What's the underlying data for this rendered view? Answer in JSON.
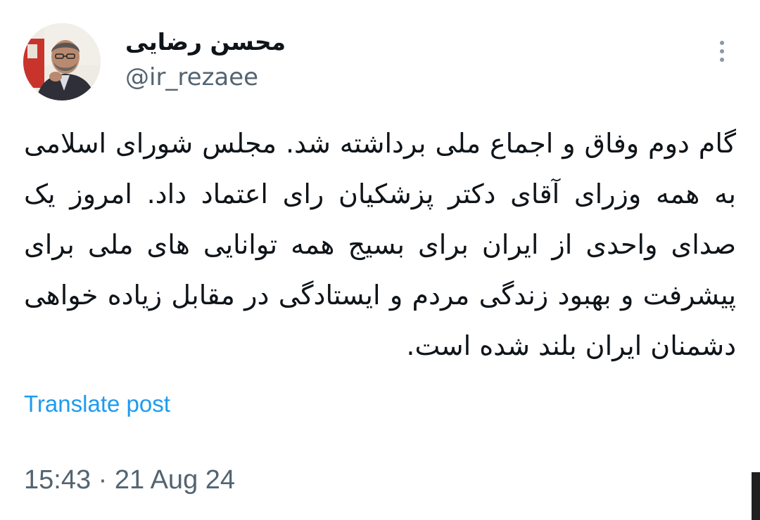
{
  "author": {
    "display_name": "محسن رضایی",
    "handle": "@ir_rezaee",
    "avatar_icon": "profile-photo"
  },
  "tweet": {
    "text": "گام دوم وفاق و اجماع ملی برداشته شد. مجلس شورای اسلامی به همه وزرای آقای دکتر پزشکیان رای اعتماد داد. امروز یک صدای واحدی از ایران برای بسیج همه توانایی های ملی برای پیشرفت و بهبود زندگی مردم و ایستادگی در مقابل زیاده خواهی دشمنان ایران بلند شده است.",
    "translate_label": "Translate post",
    "timestamp": "15:43 · 21 Aug 24"
  },
  "menu": {
    "more_icon": "more-vertical-icon"
  },
  "colors": {
    "text_primary": "#0f1419",
    "text_secondary": "#536471",
    "link": "#1d9bf0",
    "background": "#ffffff"
  }
}
